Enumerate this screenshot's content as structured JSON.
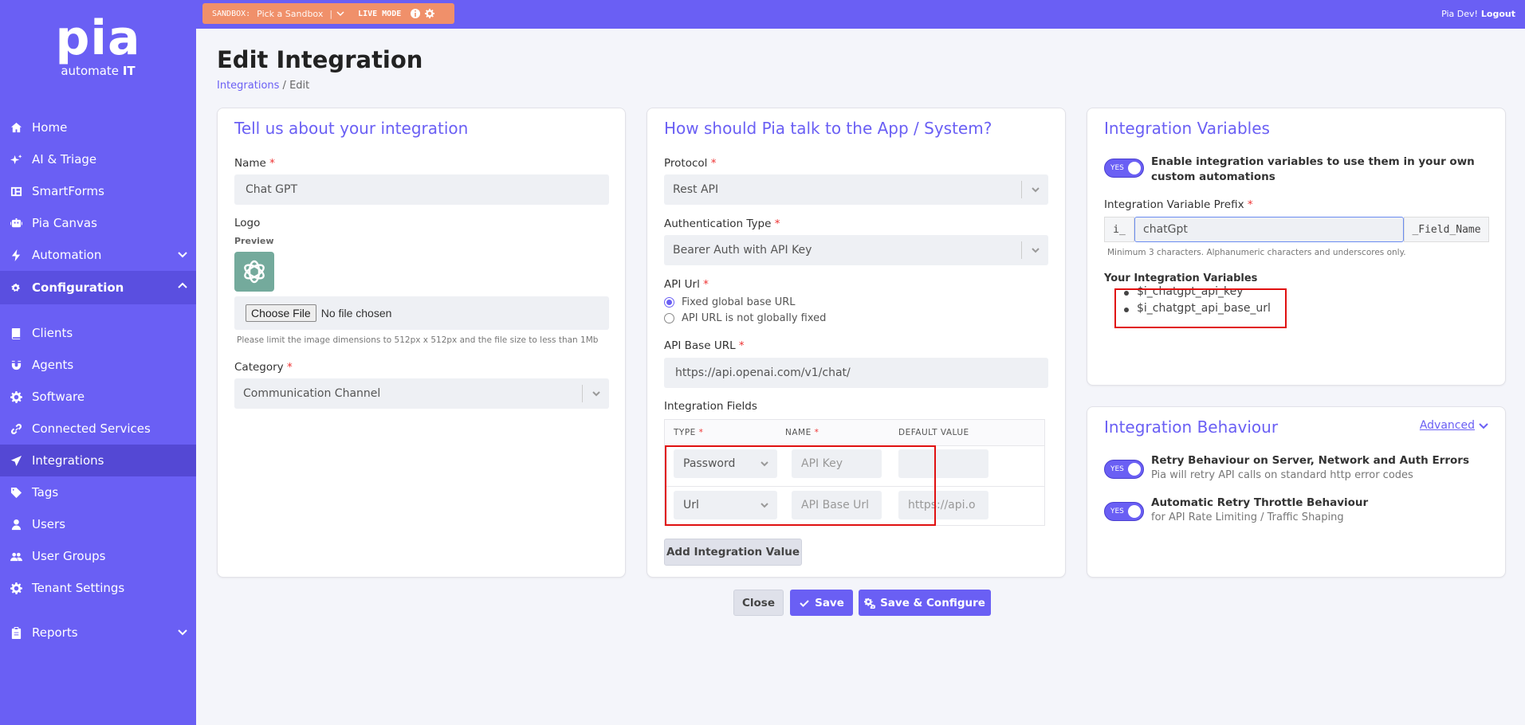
{
  "brand": {
    "logo": "pia",
    "tagline_pre": "automate ",
    "tagline_bold": "IT"
  },
  "sidebar": {
    "items": [
      {
        "label": "Home",
        "icon": "home-icon"
      },
      {
        "label": "AI & Triage",
        "icon": "sparkle-icon"
      },
      {
        "label": "SmartForms",
        "icon": "form-icon"
      },
      {
        "label": "Pia Canvas",
        "icon": "robot-icon"
      },
      {
        "label": "Automation",
        "icon": "bolt-icon"
      },
      {
        "label": "Configuration",
        "icon": "cogs-icon"
      },
      {
        "label": "Clients",
        "icon": "book-icon"
      },
      {
        "label": "Agents",
        "icon": "magnet-icon"
      },
      {
        "label": "Software",
        "icon": "gear-icon"
      },
      {
        "label": "Connected Services",
        "icon": "link-icon"
      },
      {
        "label": "Integrations",
        "icon": "send-icon"
      },
      {
        "label": "Tags",
        "icon": "tag-icon"
      },
      {
        "label": "Users",
        "icon": "user-icon"
      },
      {
        "label": "User Groups",
        "icon": "users-icon"
      },
      {
        "label": "Tenant Settings",
        "icon": "settings-icon"
      },
      {
        "label": "Reports",
        "icon": "clipboard-icon"
      }
    ]
  },
  "topbar": {
    "sandbox_label": "SANDBOX:",
    "sandbox_pick": "Pick a Sandbox",
    "live_mode": "LIVE MODE",
    "user": "Pia Dev!",
    "logout": "Logout"
  },
  "page": {
    "title": "Edit Integration",
    "crumb_link": "Integrations",
    "crumb_sep": "/",
    "crumb_current": "Edit"
  },
  "about": {
    "heading": "Tell us about your integration",
    "name_label": "Name",
    "name_value": "Chat GPT",
    "logo_label": "Logo",
    "preview_label": "Preview",
    "file_button": "Choose File",
    "file_status": "No file chosen",
    "file_hint": "Please limit the image dimensions to 512px x 512px and the file size to less than 1Mb",
    "category_label": "Category",
    "category_value": "Communication Channel"
  },
  "talk": {
    "heading": "How should Pia talk to the App / System?",
    "protocol_label": "Protocol",
    "protocol_value": "Rest API",
    "auth_label": "Authentication Type",
    "auth_value": "Bearer Auth with API Key",
    "apiurl_label": "API Url",
    "radio_fixed": "Fixed global base URL",
    "radio_not_fixed": "API URL is not globally fixed",
    "base_url_label": "API Base URL",
    "base_url_value": "https://api.openai.com/v1/chat/",
    "fields_label": "Integration Fields",
    "col_type": "TYPE",
    "col_name": "NAME",
    "col_default": "DEFAULT VALUE",
    "rows": [
      {
        "type": "Password",
        "name_placeholder": "API Key",
        "default": ""
      },
      {
        "type": "Url",
        "name_placeholder": "API Base Url",
        "default": "https://api.o"
      }
    ],
    "add_button": "Add Integration Value"
  },
  "variables": {
    "heading": "Integration Variables",
    "toggle_label": "YES",
    "enable_text": "Enable integration variables to use them in your own custom automations",
    "prefix_label": "Integration Variable Prefix",
    "prefix_addon": "i_",
    "prefix_value": "chatGpt",
    "suffix_addon": "_Field_Name",
    "prefix_hint": "Minimum 3 characters. Alphanumeric characters and underscores only.",
    "your_vars_label": "Your Integration Variables",
    "vars": [
      "$i_chatgpt_api_key",
      "$i_chatgpt_api_base_url"
    ]
  },
  "behaviour": {
    "heading": "Integration Behaviour",
    "advanced": "Advanced",
    "toggle_label": "YES",
    "retry_title": "Retry Behaviour on Server, Network and Auth Errors",
    "retry_sub": "Pia will retry API calls on standard http error codes",
    "throttle_title": "Automatic Retry Throttle Behaviour",
    "throttle_sub": "for API Rate Limiting / Traffic Shaping"
  },
  "actions": {
    "close": "Close",
    "save": "Save",
    "save_configure": "Save & Configure"
  },
  "colors": {
    "accent": "#6a5ff4",
    "sandbox": "#f0906a",
    "highlight": "#e01010"
  }
}
